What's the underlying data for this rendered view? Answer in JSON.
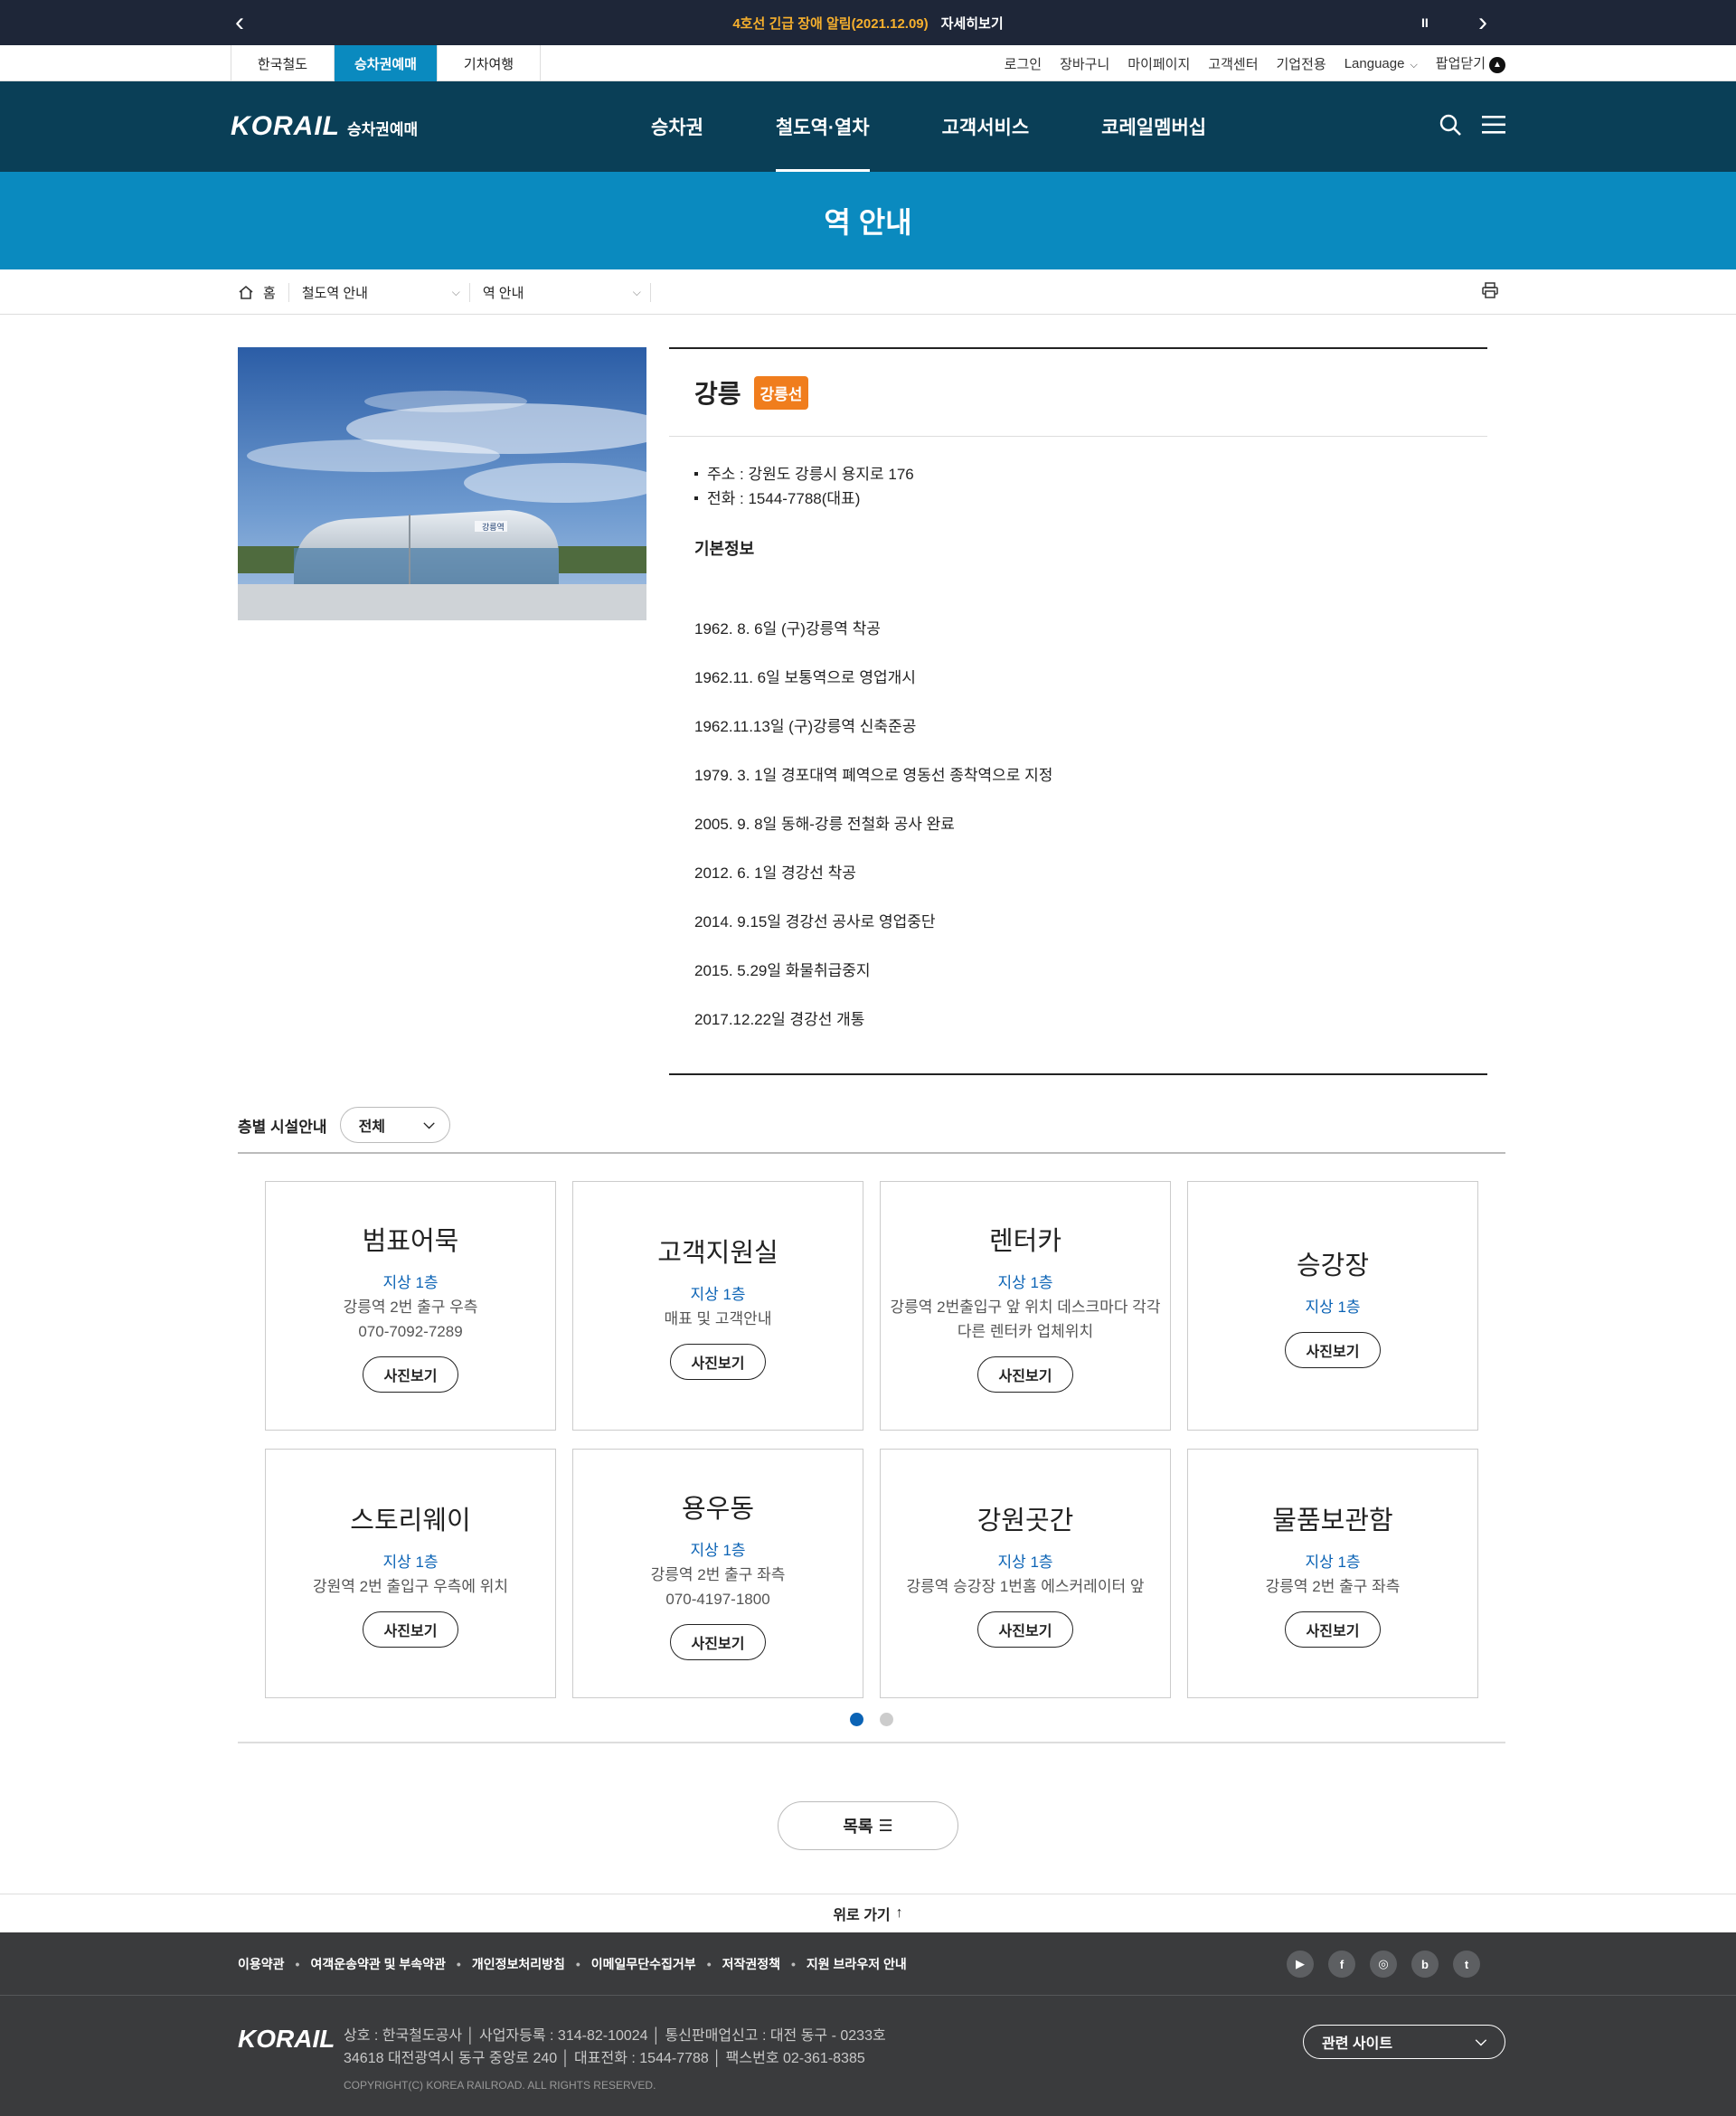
{
  "notice": {
    "alert_text": "4호선 긴급 장애 알림(2021.12.09)",
    "more_label": "자세히보기",
    "pause_label": "II"
  },
  "util": {
    "site_tabs": [
      "한국철도",
      "승차권예매",
      "기차여행"
    ],
    "links": [
      "로그인",
      "장바구니",
      "마이페이지",
      "고객센터",
      "기업전용"
    ],
    "language_label": "Language",
    "popup_close_label": "팝업닫기"
  },
  "header": {
    "logo_brand": "KORAIL",
    "logo_sub": "승차권예매",
    "menu": [
      "승차권",
      "철도역·열차",
      "고객서비스",
      "코레일멤버십"
    ]
  },
  "page_title": "역 안내",
  "breadcrumb": {
    "home": "홈",
    "level1": "철도역 안내",
    "level2": "역 안내"
  },
  "station": {
    "name": "강릉",
    "line": "강릉선",
    "sign_text": "강릉역",
    "address": "주소 : 강원도 강릉시 용지로 176",
    "phone": "전화 : 1544-7788(대표)",
    "basic_info_title": "기본정보",
    "history": [
      "1962. 8. 6일 (구)강릉역 착공",
      "1962.11. 6일 보통역으로 영업개시",
      "1962.11.13일 (구)강릉역 신축준공",
      "1979. 3. 1일 경포대역 폐역으로 영동선 종착역으로 지정",
      "2005. 9. 8일 동해-강릉 전철화 공사 완료",
      "2012. 6. 1일 경강선 착공",
      "2014. 9.15일 경강선 공사로 영업중단",
      "2015. 5.29일 화물취급중지",
      "2017.12.22일 경강선 개통"
    ]
  },
  "facilities": {
    "label": "층별 시설안내",
    "filter_value": "전체",
    "photo_button": "사진보기",
    "items": [
      {
        "name": "범표어묵",
        "floor": "지상 1층",
        "desc": [
          "강릉역 2번 출구 우측",
          "070-7092-7289"
        ]
      },
      {
        "name": "고객지원실",
        "floor": "지상 1층",
        "desc": [
          "매표 및 고객안내"
        ]
      },
      {
        "name": "렌터카",
        "floor": "지상 1층",
        "desc": [
          "강릉역 2번출입구 앞 위치 데스크마다 각각 다른 렌터카 업체위치"
        ]
      },
      {
        "name": "승강장",
        "floor": "지상 1층",
        "desc": []
      },
      {
        "name": "스토리웨이",
        "floor": "지상 1층",
        "desc": [
          "강원역 2번 출입구 우측에 위치"
        ]
      },
      {
        "name": "용우동",
        "floor": "지상 1층",
        "desc": [
          "강릉역 2번 출구 좌측",
          "070-4197-1800"
        ]
      },
      {
        "name": "강원곳간",
        "floor": "지상 1층",
        "desc": [
          "강릉역 승강장 1번홈 에스커레이터 앞"
        ]
      },
      {
        "name": "물품보관함",
        "floor": "지상 1층",
        "desc": [
          "강릉역 2번 출구 좌측"
        ]
      }
    ],
    "page_count": 2,
    "current_page": 1
  },
  "list_button": "목록",
  "to_top": "위로 가기",
  "footer": {
    "links": [
      "이용약관",
      "여객운송약관 및 부속약관",
      "개인정보처리방침",
      "이메일무단수집거부",
      "저작권정책",
      "지원 브라우저 안내"
    ],
    "sns": [
      "youtube-icon",
      "facebook-icon",
      "instagram-icon",
      "blog-icon",
      "twitter-icon"
    ],
    "logo": "KORAIL",
    "addr_line1": "상호 : 한국철도공사 │ 사업자등록 : 314-82-10024 │ 통신판매업신고 : 대전 동구 - 0233호",
    "addr_line2": "34618 대전광역시 동구 중앙로 240 │ 대표전화 : 1544-7788 │ 팩스번호 02-361-8385",
    "copyright": "COPYRIGHT(C) KOREA RAILROAD. ALL RIGHTS RESERVED.",
    "related_label": "관련 사이트"
  },
  "colors": {
    "header_bg": "#0a3f57",
    "accent_blue": "#0a8abf",
    "line_badge": "#f07d1d",
    "floor_text": "#0b63b5",
    "notice_alert": "#f7b02d"
  }
}
